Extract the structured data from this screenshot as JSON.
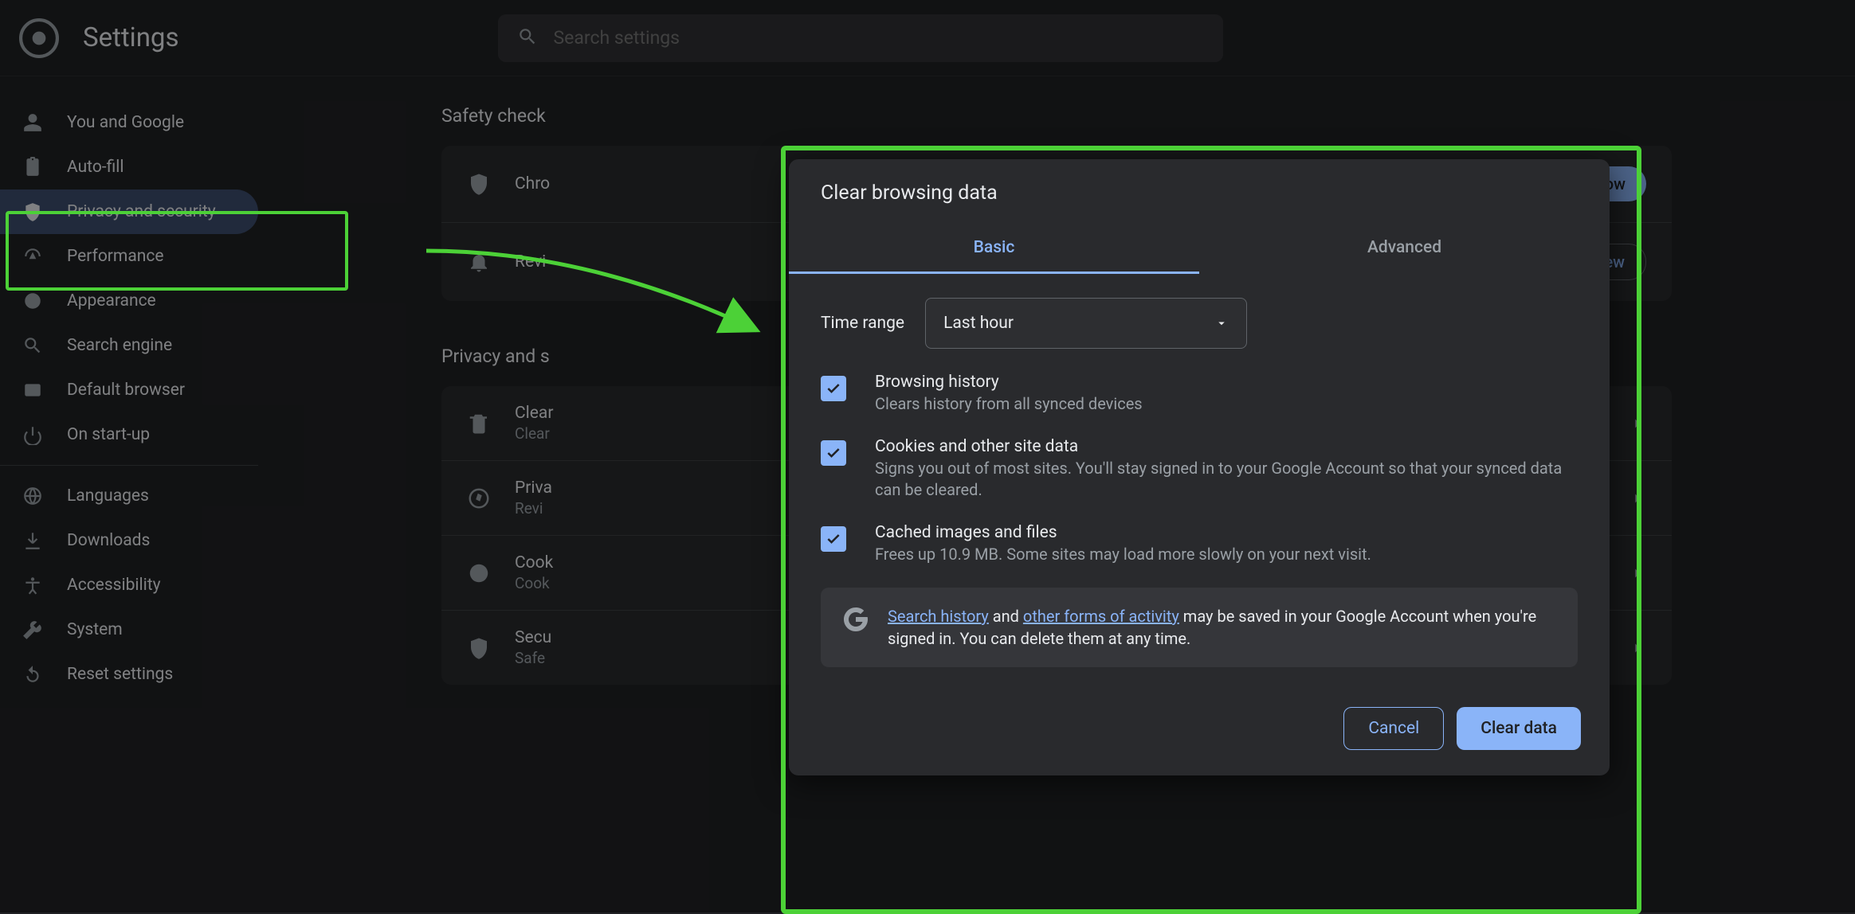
{
  "header": {
    "title": "Settings",
    "search_placeholder": "Search settings"
  },
  "sidebar": {
    "items": [
      {
        "label": "You and Google"
      },
      {
        "label": "Auto-fill"
      },
      {
        "label": "Privacy and security"
      },
      {
        "label": "Performance"
      },
      {
        "label": "Appearance"
      },
      {
        "label": "Search engine"
      },
      {
        "label": "Default browser"
      },
      {
        "label": "On start-up"
      },
      {
        "label": "Languages"
      },
      {
        "label": "Downloads"
      },
      {
        "label": "Accessibility"
      },
      {
        "label": "System"
      },
      {
        "label": "Reset settings"
      }
    ]
  },
  "main": {
    "safety_title": "Safety check",
    "safety_row1": "Chro",
    "safety_check_now": "eck now",
    "safety_row2": "Revi",
    "safety_review": "Review",
    "privsec_title": "Privacy and s",
    "rows": [
      {
        "t1": "Clear",
        "t2": "Clear"
      },
      {
        "t1": "Priva",
        "t2": "Revi"
      },
      {
        "t1": "Cook",
        "t2": "Cook"
      },
      {
        "t1": "Secu",
        "t2": "Safe"
      }
    ]
  },
  "modal": {
    "title": "Clear browsing data",
    "tabs": {
      "basic": "Basic",
      "advanced": "Advanced"
    },
    "time_label": "Time range",
    "time_value": "Last hour",
    "options": [
      {
        "title": "Browsing history",
        "desc": "Clears history from all synced devices"
      },
      {
        "title": "Cookies and other site data",
        "desc": "Signs you out of most sites. You'll stay signed in to your Google Account so that your synced data can be cleared."
      },
      {
        "title": "Cached images and files",
        "desc": "Frees up 10.9 MB. Some sites may load more slowly on your next visit."
      }
    ],
    "info": {
      "link1": "Search history",
      "mid": " and ",
      "link2": "other forms of activity",
      "tail": " may be saved in your Google Account when you're signed in. You can delete them at any time."
    },
    "cancel": "Cancel",
    "clear": "Clear data"
  }
}
